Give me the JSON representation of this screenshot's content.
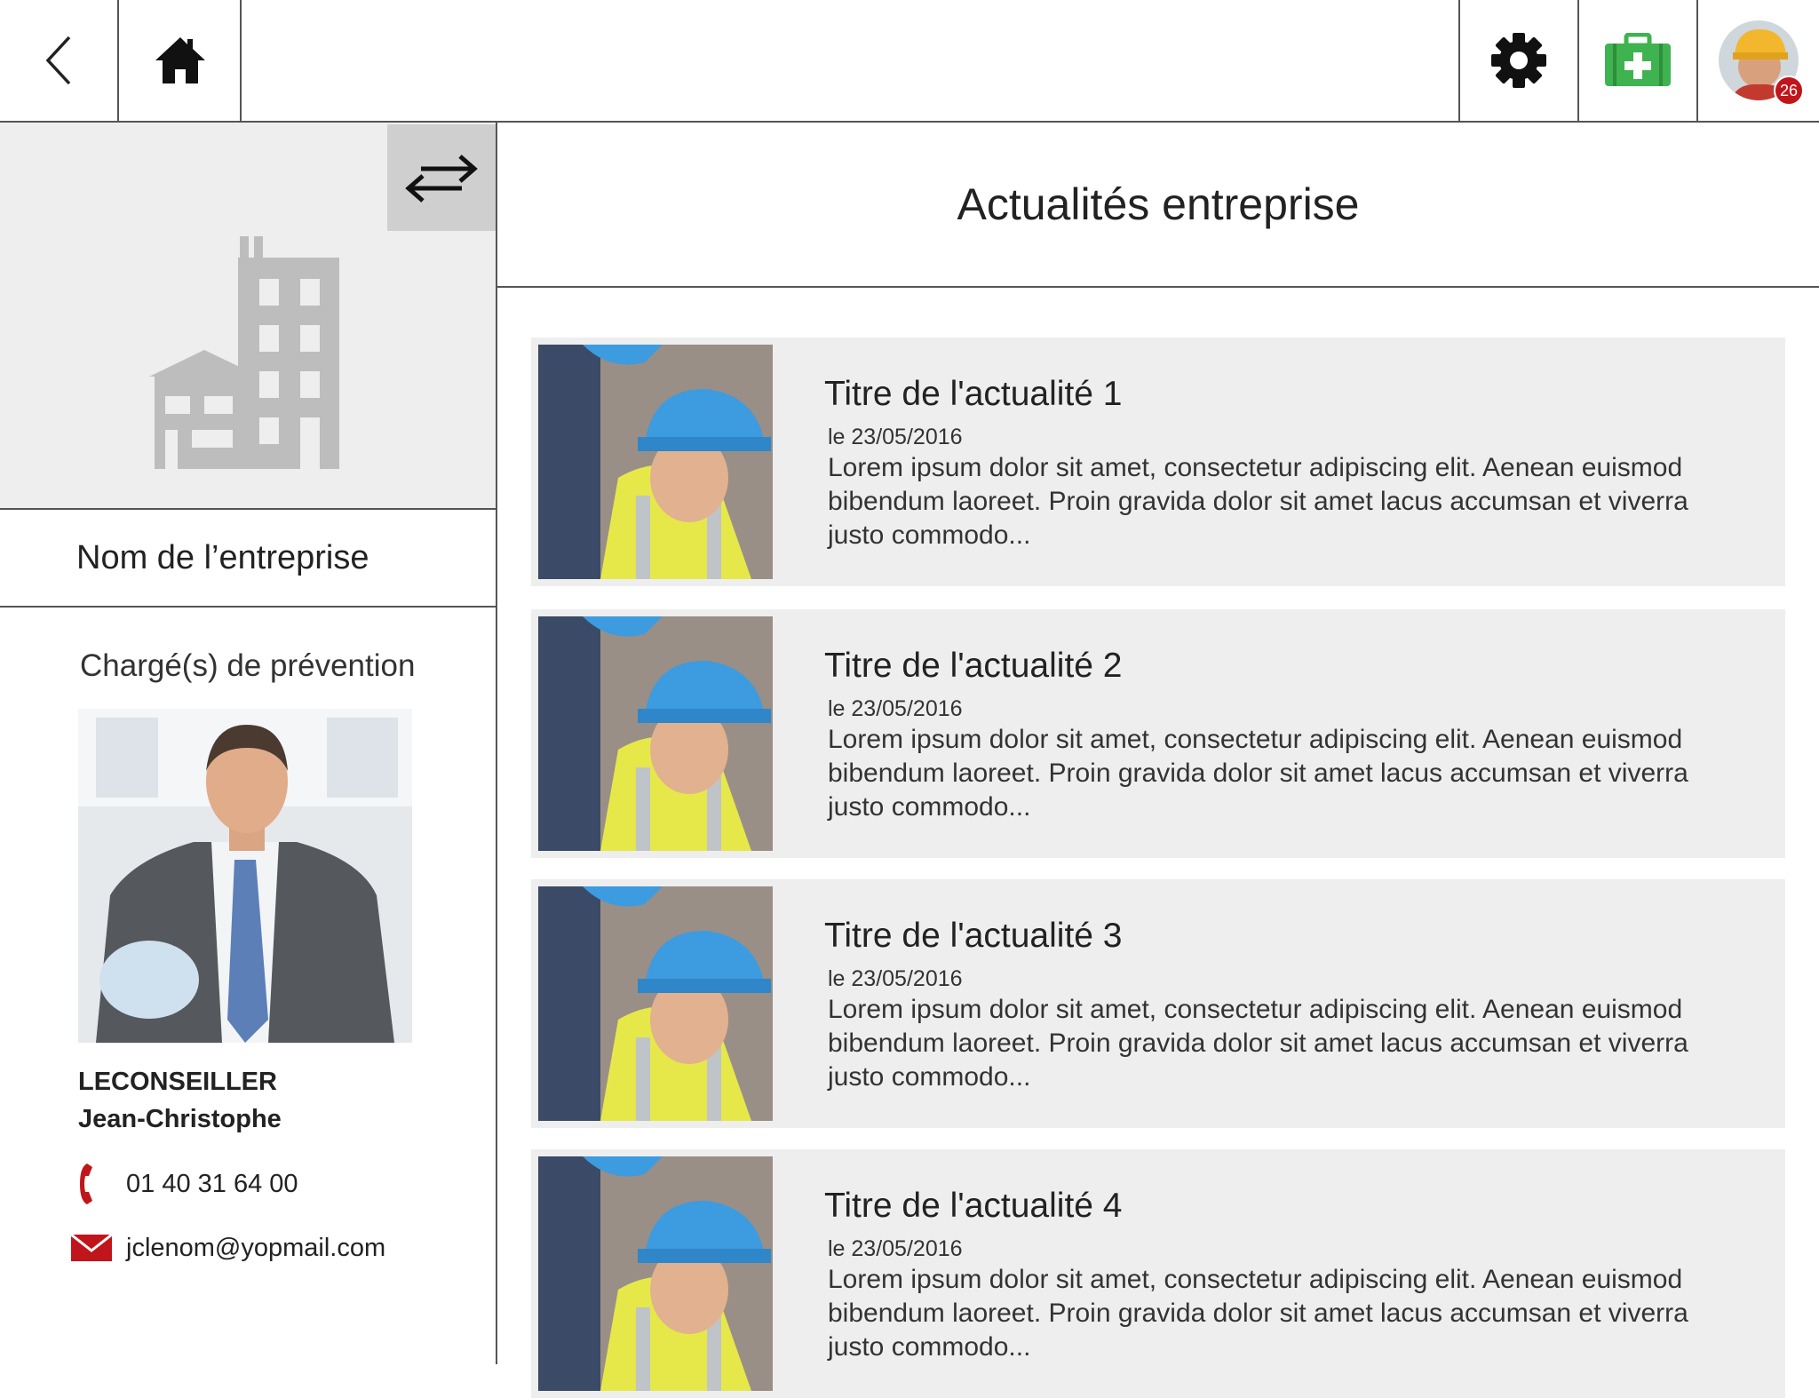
{
  "topbar": {
    "back_icon": "chevron-left-icon",
    "home_icon": "home-icon",
    "settings_icon": "gear-icon",
    "first_aid_icon": "first-aid-kit-icon",
    "notification_count": "26",
    "colors": {
      "first_aid": "#3fb34f",
      "badge": "#c0151b"
    }
  },
  "company": {
    "swap_icon": "swap-arrows-icon",
    "building_icon": "building-icon",
    "name": "Nom de l’entreprise"
  },
  "prevention": {
    "title": "Chargé(s) de prévention",
    "advisor": {
      "last_name": "LECONSEILLER",
      "first_name": "Jean-Christophe",
      "phone": "01 40 31 64 00",
      "email": "jclenom@yopmail.com"
    },
    "colors": {
      "contact_icons": "#c0151b"
    }
  },
  "main": {
    "title": "Actualités entreprise",
    "news": [
      {
        "title": "Titre de l'actualité 1",
        "date": "le 23/05/2016",
        "excerpt": "Lorem ipsum dolor sit amet, consectetur adipiscing elit. Aenean euismod bibendum laoreet. Proin gravida dolor sit amet lacus accumsan et viverra justo commodo..."
      },
      {
        "title": "Titre de l'actualité 2",
        "date": "le 23/05/2016",
        "excerpt": "Lorem ipsum dolor sit amet, consectetur adipiscing elit. Aenean euismod bibendum laoreet. Proin gravida dolor sit amet lacus accumsan et viverra justo commodo..."
      },
      {
        "title": "Titre de l'actualité 3",
        "date": "le 23/05/2016",
        "excerpt": "Lorem ipsum dolor sit amet, consectetur adipiscing elit. Aenean euismod bibendum laoreet. Proin gravida dolor sit amet lacus accumsan et viverra justo commodo..."
      },
      {
        "title": "Titre de l'actualité 4",
        "date": "le 23/05/2016",
        "excerpt": "Lorem ipsum dolor sit amet, consectetur adipiscing elit. Aenean euismod bibendum laoreet. Proin gravida dolor sit amet lacus accumsan et viverra justo commodo..."
      }
    ]
  }
}
